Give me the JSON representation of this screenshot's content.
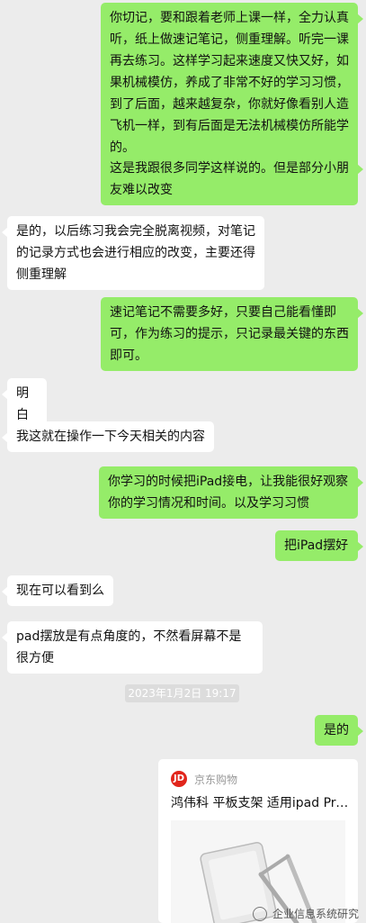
{
  "messages": [
    {
      "side": "out",
      "text": "你切记，要和跟着老师上课一样，全力认真听，纸上做速记笔记，侧重理解。听完一课再去练习。这样学习起来速度又快又好，如果机械模仿，养成了非常不好的学习习惯，到了后面，越来越复杂，你就好像看别人造飞机一样，到有后面是无法机械模仿所能学的。"
    },
    {
      "side": "out",
      "text": "这是我跟很多同学这样说的。但是部分小朋友难以改变"
    },
    {
      "side": "in",
      "text": "是的，以后练习我会完全脱离视频，对笔记的记录方式也会进行相应的改变，主要还得侧重理解"
    },
    {
      "side": "out",
      "text": "速记笔记不需要多好，只要自己能看懂即可，作为练习的提示，只记录最关键的东西即可。"
    },
    {
      "side": "in",
      "text": "明白"
    },
    {
      "side": "in",
      "text": "我这就在操作一下今天相关的内容"
    },
    {
      "side": "out",
      "text": "你学习的时候把iPad接电，让我能很好观察你的学习情况和时间。以及学习习惯"
    },
    {
      "side": "out",
      "text": "把iPad摆好"
    },
    {
      "side": "in",
      "text": "现在可以看到么"
    },
    {
      "side": "in",
      "text": "pad摆放是有点角度的，不然看屏幕不是很方便"
    },
    {
      "side": "out",
      "text": "是的"
    }
  ],
  "timestamp": "2023年1月2日 19:17",
  "card": {
    "source": "京东购物",
    "logo_text": "JD",
    "title": "鸿伟科 平板支架 适用ipad Pro..."
  },
  "watermark": "企业信息系统研究",
  "colors": {
    "outgoing": "#95ec69",
    "incoming": "#ffffff",
    "background": "#ececec"
  }
}
